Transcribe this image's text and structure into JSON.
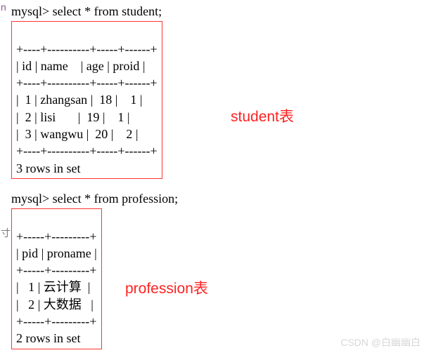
{
  "left_markers": {
    "top": "n",
    "mid": "寸"
  },
  "queries": {
    "student": "mysql> select * from student;",
    "profession": "mysql> select * from profession;"
  },
  "student_output": {
    "sep": "+----+----------+-----+------+",
    "header": "| id | name    | age | proid |",
    "rows": [
      "|  1 | zhangsan |  18 |    1 |",
      "|  2 | lisi       |  19 |    1 |",
      "|  3 | wangwu |  20 |    2 |"
    ],
    "footer": "3 rows in set"
  },
  "profession_output": {
    "sep": "+-----+---------+",
    "header": "| pid | proname |",
    "rows": [
      "|   1 | 云计算  |",
      "|   2 | 大数据   |"
    ],
    "footer": "2 rows in set"
  },
  "labels": {
    "student": "student表",
    "profession": "profession表"
  },
  "watermark": "CSDN @白幽幽白"
}
